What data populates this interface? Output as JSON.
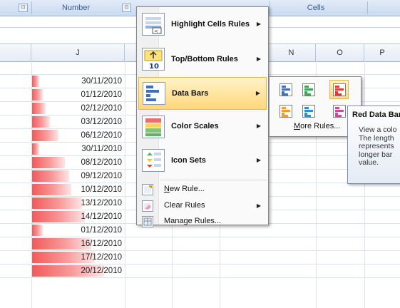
{
  "ribbon": {
    "group_number": "Number",
    "group_cells": "Cells",
    "launcher_glyph": "⊡"
  },
  "columns": [
    "J",
    "N",
    "O",
    "P"
  ],
  "cells": [
    {
      "date": "30/11/2010",
      "bar_fraction": 0.08
    },
    {
      "date": "01/12/2010",
      "bar_fraction": 0.12
    },
    {
      "date": "02/12/2010",
      "bar_fraction": 0.15
    },
    {
      "date": "03/12/2010",
      "bar_fraction": 0.19
    },
    {
      "date": "06/12/2010",
      "bar_fraction": 0.29
    },
    {
      "date": "30/11/2010",
      "bar_fraction": 0.08
    },
    {
      "date": "08/12/2010",
      "bar_fraction": 0.36
    },
    {
      "date": "09/12/2010",
      "bar_fraction": 0.4
    },
    {
      "date": "10/12/2010",
      "bar_fraction": 0.43
    },
    {
      "date": "13/12/2010",
      "bar_fraction": 0.54
    },
    {
      "date": "14/12/2010",
      "bar_fraction": 0.57
    },
    {
      "date": "01/12/2010",
      "bar_fraction": 0.12
    },
    {
      "date": "16/12/2010",
      "bar_fraction": 0.64
    },
    {
      "date": "17/12/2010",
      "bar_fraction": 0.68
    },
    {
      "date": "20/12/2010",
      "bar_fraction": 0.78
    }
  ],
  "menu": {
    "highlight": "Highlight Cells Rules",
    "topbottom": "Top/Bottom Rules",
    "databars": "Data Bars",
    "colorscales": "Color Scales",
    "iconsets": "Icon Sets",
    "newrule": "New Rule...",
    "clearrules": "Clear Rules",
    "managerules": "Manage Rules..."
  },
  "submenu": {
    "more_rules": "More Rules...",
    "swatch_colors": [
      "blue",
      "green",
      "red",
      "orange",
      "light-blue",
      "purple"
    ]
  },
  "tooltip": {
    "title": "Red Data Bar",
    "lines": [
      "View a colo",
      "The length",
      "represents",
      "longer bar",
      "value."
    ]
  },
  "colors": {
    "bar_red": "#f25a5a",
    "menu_highlight": "#ffd77a"
  }
}
